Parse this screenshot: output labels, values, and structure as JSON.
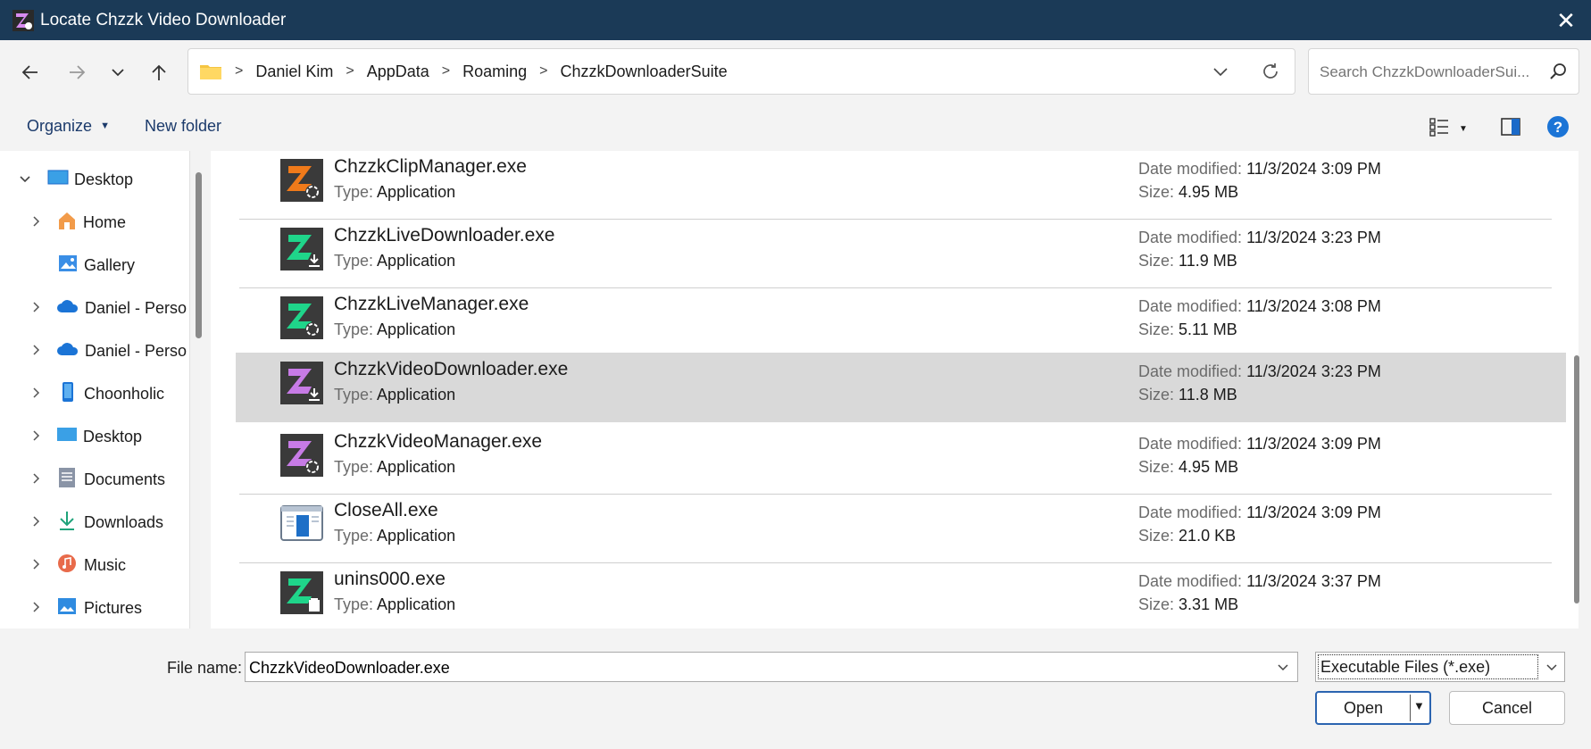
{
  "window": {
    "title": "Locate Chzzk Video Downloader",
    "close_label": "✕"
  },
  "address": {
    "crumbs": [
      "Daniel Kim",
      "AppData",
      "Roaming",
      "ChzzkDownloaderSuite"
    ]
  },
  "search": {
    "placeholder": "Search ChzzkDownloaderSui..."
  },
  "toolbar": {
    "organize_label": "Organize",
    "new_folder_label": "New folder"
  },
  "sidebar": {
    "items": [
      {
        "label": "Desktop",
        "icon": "desktop-icon",
        "expanded": true
      },
      {
        "label": "Home",
        "icon": "home-icon"
      },
      {
        "label": "Gallery",
        "icon": "gallery-icon"
      },
      {
        "label": "Daniel - Persor",
        "icon": "onedrive-icon"
      },
      {
        "label": "Daniel - Persor",
        "icon": "onedrive-icon"
      },
      {
        "label": "Choonholic",
        "icon": "phone-icon"
      },
      {
        "label": "Desktop",
        "icon": "desktop-icon"
      },
      {
        "label": "Documents",
        "icon": "documents-icon"
      },
      {
        "label": "Downloads",
        "icon": "downloads-icon"
      },
      {
        "label": "Music",
        "icon": "music-icon"
      },
      {
        "label": "Pictures",
        "icon": "pictures-icon"
      }
    ]
  },
  "labels": {
    "type": "Type:",
    "date_modified": "Date modified:",
    "size": "Size:"
  },
  "files": [
    {
      "name": "ChzzkClipManager.exe",
      "type": "Application",
      "date": "11/3/2024 3:09 PM",
      "size": "4.95 MB",
      "icon": "chzzk-clip-manager-icon",
      "color": "#f07a1a",
      "badge": "gear"
    },
    {
      "name": "ChzzkLiveDownloader.exe",
      "type": "Application",
      "date": "11/3/2024 3:23 PM",
      "size": "11.9 MB",
      "icon": "chzzk-live-downloader-icon",
      "color": "#1fd58a",
      "badge": "download"
    },
    {
      "name": "ChzzkLiveManager.exe",
      "type": "Application",
      "date": "11/3/2024 3:08 PM",
      "size": "5.11 MB",
      "icon": "chzzk-live-manager-icon",
      "color": "#1fd58a",
      "badge": "gear"
    },
    {
      "name": "ChzzkVideoDownloader.exe",
      "type": "Application",
      "date": "11/3/2024 3:23 PM",
      "size": "11.8 MB",
      "icon": "chzzk-video-downloader-icon",
      "color": "#c77be6",
      "badge": "download",
      "selected": true
    },
    {
      "name": "ChzzkVideoManager.exe",
      "type": "Application",
      "date": "11/3/2024 3:09 PM",
      "size": "4.95 MB",
      "icon": "chzzk-video-manager-icon",
      "color": "#c77be6",
      "badge": "gear"
    },
    {
      "name": "CloseAll.exe",
      "type": "Application",
      "date": "11/3/2024 3:09 PM",
      "size": "21.0 KB",
      "icon": "closeall-app-icon",
      "color": "#1e6fc7",
      "badge": "none"
    },
    {
      "name": "unins000.exe",
      "type": "Application",
      "date": "11/3/2024 3:37 PM",
      "size": "3.31 MB",
      "icon": "uninstaller-icon",
      "color": "#1fd58a",
      "badge": "box"
    }
  ],
  "bottom": {
    "file_name_label": "File name:",
    "file_name_value": "ChzzkVideoDownloader.exe",
    "file_type": "Executable Files (*.exe)",
    "open_label": "Open",
    "cancel_label": "Cancel"
  },
  "colors": {
    "titlebar": "#1b3a57",
    "accent": "#2b64b0",
    "selected_row": "#d9d9d9"
  }
}
